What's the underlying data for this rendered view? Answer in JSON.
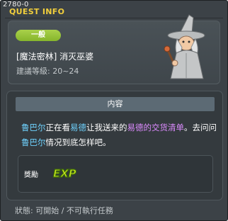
{
  "window": {
    "quest_id": "2780-0",
    "title": "QUEST INFO"
  },
  "quest": {
    "category_badge": "一般",
    "name": "[魔法密林] 消灭巫婆",
    "level_requirement": "建議等級: 20~24"
  },
  "content": {
    "header": "内容",
    "description_parts": {
      "npc1": "鲁巴尔",
      "t1": "正在看",
      "npc2": "易德",
      "t2": "让我送来的",
      "item": "易德的交货清单",
      "t3": "。去问问",
      "npc3": "鲁巴尔",
      "t4": "情况到底怎样吧。"
    }
  },
  "reward": {
    "label": "獎勵",
    "exp_text": "EXP"
  },
  "status": {
    "text": "狀態:  可開始 / 不可執行任務"
  },
  "colors": {
    "title": "#f2cf3c",
    "badge": "#99c43b",
    "npc_name": "#6fd3ff",
    "item_name": "#dd8bff"
  }
}
